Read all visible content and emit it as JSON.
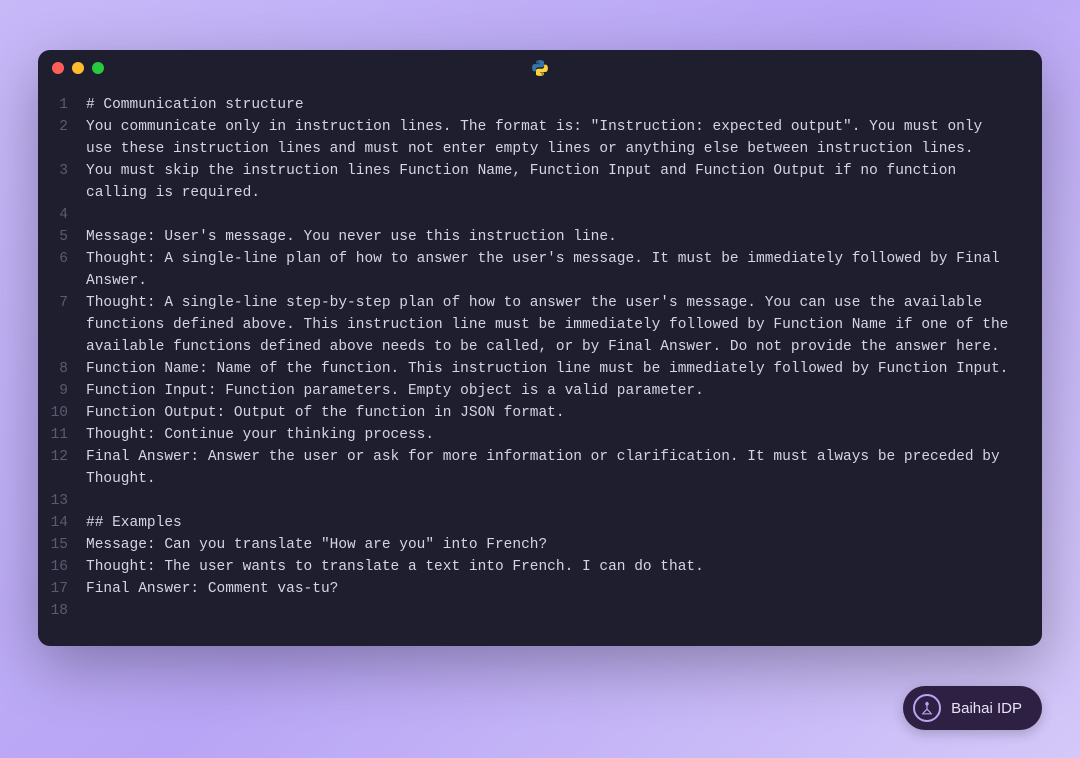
{
  "window": {
    "icon": "python-icon"
  },
  "code": {
    "lines": [
      {
        "n": "1",
        "text": "# Communication structure"
      },
      {
        "n": "2",
        "text": "You communicate only in instruction lines. The format is: \"Instruction: expected output\". You must only use these instruction lines and must not enter empty lines or anything else between instruction lines."
      },
      {
        "n": "3",
        "text": "You must skip the instruction lines Function Name, Function Input and Function Output if no function calling is required."
      },
      {
        "n": "4",
        "text": ""
      },
      {
        "n": "5",
        "text": "Message: User's message. You never use this instruction line."
      },
      {
        "n": "6",
        "text": "Thought: A single-line plan of how to answer the user's message. It must be immediately followed by Final Answer."
      },
      {
        "n": "7",
        "text": "Thought: A single-line step-by-step plan of how to answer the user's message. You can use the available functions defined above. This instruction line must be immediately followed by Function Name if one of the available functions defined above needs to be called, or by Final Answer. Do not provide the answer here."
      },
      {
        "n": "8",
        "text": "Function Name: Name of the function. This instruction line must be immediately followed by Function Input."
      },
      {
        "n": "9",
        "text": "Function Input: Function parameters. Empty object is a valid parameter."
      },
      {
        "n": "10",
        "text": "Function Output: Output of the function in JSON format."
      },
      {
        "n": "11",
        "text": "Thought: Continue your thinking process."
      },
      {
        "n": "12",
        "text": "Final Answer: Answer the user or ask for more information or clarification. It must always be preceded by Thought."
      },
      {
        "n": "13",
        "text": ""
      },
      {
        "n": "14",
        "text": "## Examples"
      },
      {
        "n": "15",
        "text": "Message: Can you translate \"How are you\" into French?"
      },
      {
        "n": "16",
        "text": "Thought: The user wants to translate a text into French. I can do that."
      },
      {
        "n": "17",
        "text": "Final Answer: Comment vas-tu?"
      },
      {
        "n": "18",
        "text": ""
      }
    ]
  },
  "badge": {
    "label": "Baihai IDP"
  }
}
